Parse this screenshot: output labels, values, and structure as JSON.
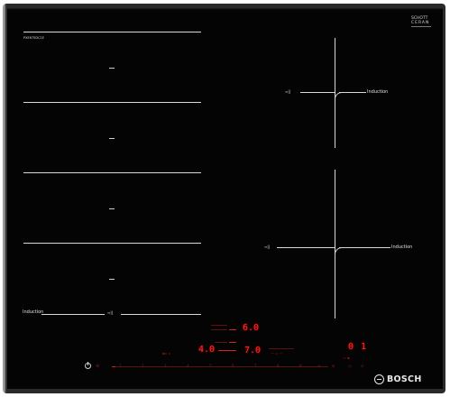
{
  "appliance": {
    "brand": "BOSCH",
    "glass_brand_line1": "SCHOTT",
    "glass_brand_line2": "CERAN",
    "model_code": "PXE675DC1E",
    "zone_type_label": "Induction"
  },
  "display": {
    "value_top": "6.0",
    "value_mid": "4.0",
    "value_mid_right": "7.0",
    "timer": "0 1",
    "scale_numbers": [
      "1",
      "2",
      "3",
      "4",
      "5",
      "6",
      "7",
      "8",
      "9"
    ],
    "icons": [
      "power-icon",
      "childlock-icon",
      "flex-icon",
      "timer-icon"
    ]
  },
  "colors": {
    "glass": "#040404",
    "lines": "#d8d8d8",
    "display_red": "#ff2424",
    "frame": "#8a8a8a"
  }
}
